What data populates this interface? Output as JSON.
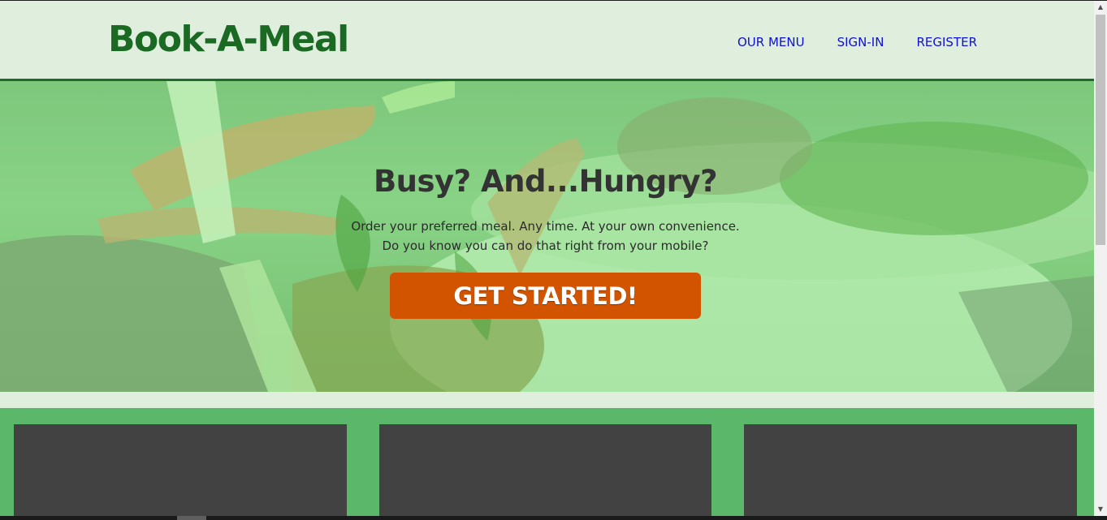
{
  "header": {
    "brand": "Book-A-Meal",
    "nav": [
      {
        "label": "OUR MENU"
      },
      {
        "label": "SIGN-IN"
      },
      {
        "label": "REGISTER"
      }
    ]
  },
  "hero": {
    "headline": "Busy? And...Hungry?",
    "line1": "Order your preferred meal. Any time. At your own convenience.",
    "line2": "Do you know you can do that right from your mobile?",
    "cta_label": "GET STARTED!"
  },
  "scrollbar": {
    "up_glyph": "▲",
    "down_glyph": "▼"
  },
  "colors": {
    "brand": "#1b6a24",
    "nav_link": "#1010d0",
    "cta": "#d35400",
    "card": "#424242",
    "cards_band": "#5bb86a"
  }
}
